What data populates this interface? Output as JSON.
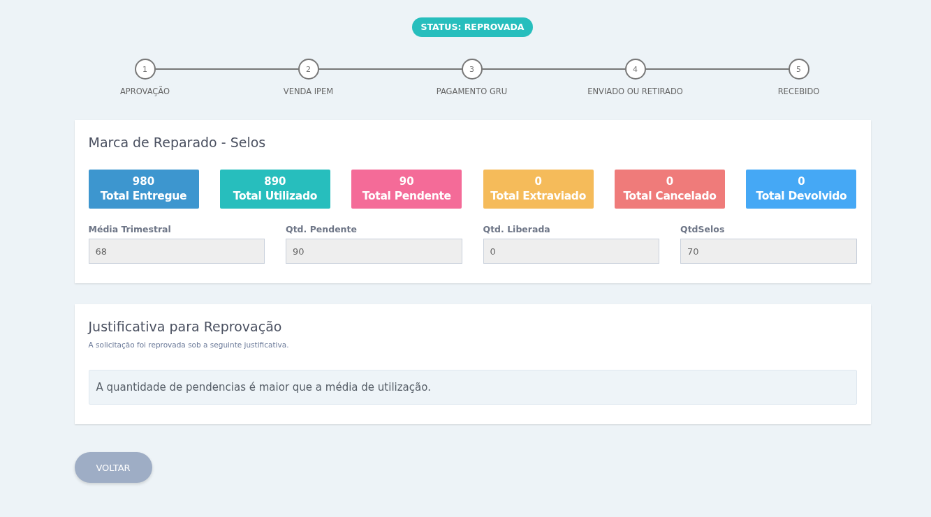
{
  "status": {
    "label": "STATUS: REPROVADA"
  },
  "steps": [
    {
      "number": "1",
      "label": "APROVAÇÃO"
    },
    {
      "number": "2",
      "label": "VENDA IPEM"
    },
    {
      "number": "3",
      "label": "PAGAMENTO GRU"
    },
    {
      "number": "4",
      "label": "ENVIADO OU RETIRADO"
    },
    {
      "number": "5",
      "label": "RECEBIDO"
    }
  ],
  "summary_card": {
    "title": "Marca de Reparado - Selos",
    "stats": [
      {
        "value": "980",
        "label": "Total Entregue",
        "color": "#3d96cf"
      },
      {
        "value": "890",
        "label": "Total Utilizado",
        "color": "#27bebd"
      },
      {
        "value": "90",
        "label": "Total Pendente",
        "color": "#f46b98"
      },
      {
        "value": "0",
        "label": "Total Extraviado",
        "color": "#f5bb5a"
      },
      {
        "value": "0",
        "label": "Total Cancelado",
        "color": "#ef7b7a"
      },
      {
        "value": "0",
        "label": "Total Devolvido",
        "color": "#45a8f5"
      }
    ],
    "fields": [
      {
        "label": "Média Trimestral",
        "value": "68",
        "disabled": true
      },
      {
        "label": "Qtd. Pendente",
        "value": "90",
        "disabled": true
      },
      {
        "label": "Qtd. Liberada",
        "value": "0",
        "disabled": true
      },
      {
        "label": "QtdSelos",
        "value": "70",
        "disabled": true
      }
    ]
  },
  "justification_card": {
    "title": "Justificativa para Reprovação",
    "subtitle": "A solicitação foi reprovada sob a seguinte justificativa.",
    "message": "A quantidade de pendencias é maior que a média de utilização."
  },
  "buttons": [
    {
      "label": "VOLTAR"
    }
  ]
}
